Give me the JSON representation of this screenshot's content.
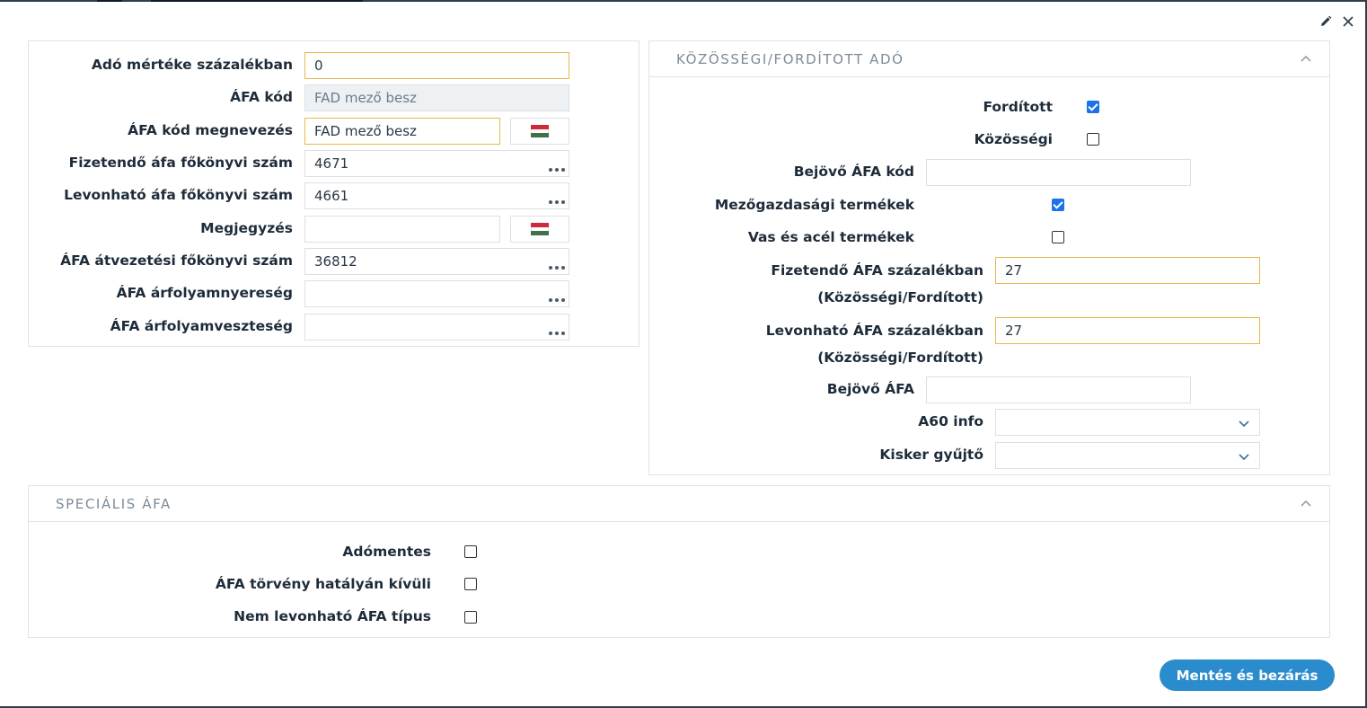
{
  "left": {
    "rate_label": "Adó mértéke százalékban",
    "rate_value": "0",
    "code_label": "ÁFA kód",
    "code_value": "FAD mező besz",
    "name_label": "ÁFA kód megnevezés",
    "name_value": "FAD mező besz",
    "payable_label": "Fizetendő áfa főkönyvi szám",
    "payable_value": "4671",
    "deductible_label": "Levonható áfa főkönyvi szám",
    "deductible_value": "4661",
    "note_label": "Megjegyzés",
    "note_value": "",
    "transfer_label": "ÁFA átvezetési főkönyvi szám",
    "transfer_value": "36812",
    "fx_gain_label": "ÁFA árfolyamnyereség",
    "fx_gain_value": "",
    "fx_loss_label": "ÁFA árfolyamveszteség",
    "fx_loss_value": ""
  },
  "community": {
    "title": "KÖZÖSSÉGI/FORDÍTOTT ADÓ",
    "reverse_label": "Fordított",
    "reverse_checked": true,
    "community_label": "Közösségi",
    "community_checked": false,
    "incoming_code_label": "Bejövő ÁFA kód",
    "incoming_code_value": "",
    "agri_label": "Mezőgazdasági termékek",
    "agri_checked": true,
    "steel_label": "Vas és acél termékek",
    "steel_checked": false,
    "payable_pct_label": "Fizetendő ÁFA százalékban (Közösségi/Fordított)",
    "payable_pct_value": "27",
    "deductible_pct_label": "Levonható ÁFA százalékban (Közösségi/Fordított)",
    "deductible_pct_value": "27",
    "incoming_label": "Bejövő ÁFA",
    "incoming_value": "",
    "a60_label": "A60 info",
    "a60_value": "",
    "retail_label": "Kisker gyűjtő",
    "retail_value": ""
  },
  "special": {
    "title": "SPECIÁLIS ÁFA",
    "exempt_label": "Adómentes",
    "exempt_checked": false,
    "outside_label": "ÁFA törvény hatályán kívüli",
    "outside_checked": false,
    "nondeductible_label": "Nem levonható ÁFA típus",
    "nondeductible_checked": false
  },
  "footer": {
    "save_label": "Mentés és bezárás"
  },
  "colors": {
    "accent": "#2a8ccc",
    "focus_border": "#e6b84a",
    "checkbox": "#1a73e8",
    "flag": [
      "#cd2a3e",
      "#ffffff",
      "#436f4d"
    ]
  },
  "icons": {
    "edit": "pencil-icon",
    "close": "close-icon",
    "collapse": "chevron-up-icon",
    "dropdown": "chevron-down-icon",
    "lookup": "ellipsis-icon",
    "translate": "hungarian-flag-icon"
  }
}
